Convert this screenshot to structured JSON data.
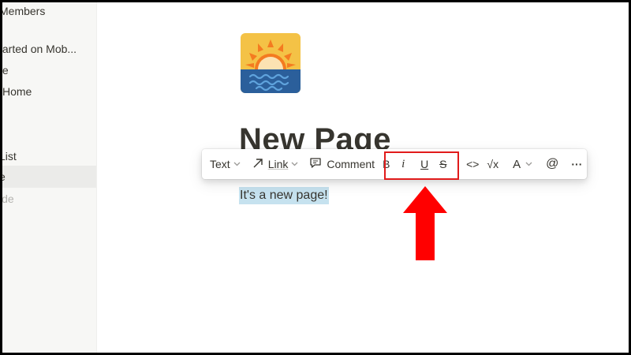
{
  "sidebar": {
    "items": [
      {
        "label": "Members"
      },
      {
        "label": "tarted on Mob..."
      },
      {
        "label": "te"
      },
      {
        "label": "Home"
      },
      {
        "label": "List"
      },
      {
        "label": "e"
      },
      {
        "label": "ide"
      }
    ]
  },
  "page": {
    "title": "New Page",
    "body_text": "It's a new page!"
  },
  "toolbar": {
    "text_label": "Text",
    "link_label": "Link",
    "comment_label": "Comment",
    "bold_label": "B",
    "italic_label": "i",
    "underline_label": "U",
    "strike_label": "S",
    "code_label": "<>",
    "equation_label": "√x",
    "color_label": "A",
    "mention_label": "@",
    "more_label": "···"
  },
  "colors": {
    "highlight_box": "#e11b1b",
    "arrow": "#ff0000",
    "selection": "#c6e2ef",
    "sidebar_bg": "#f7f7f5"
  }
}
